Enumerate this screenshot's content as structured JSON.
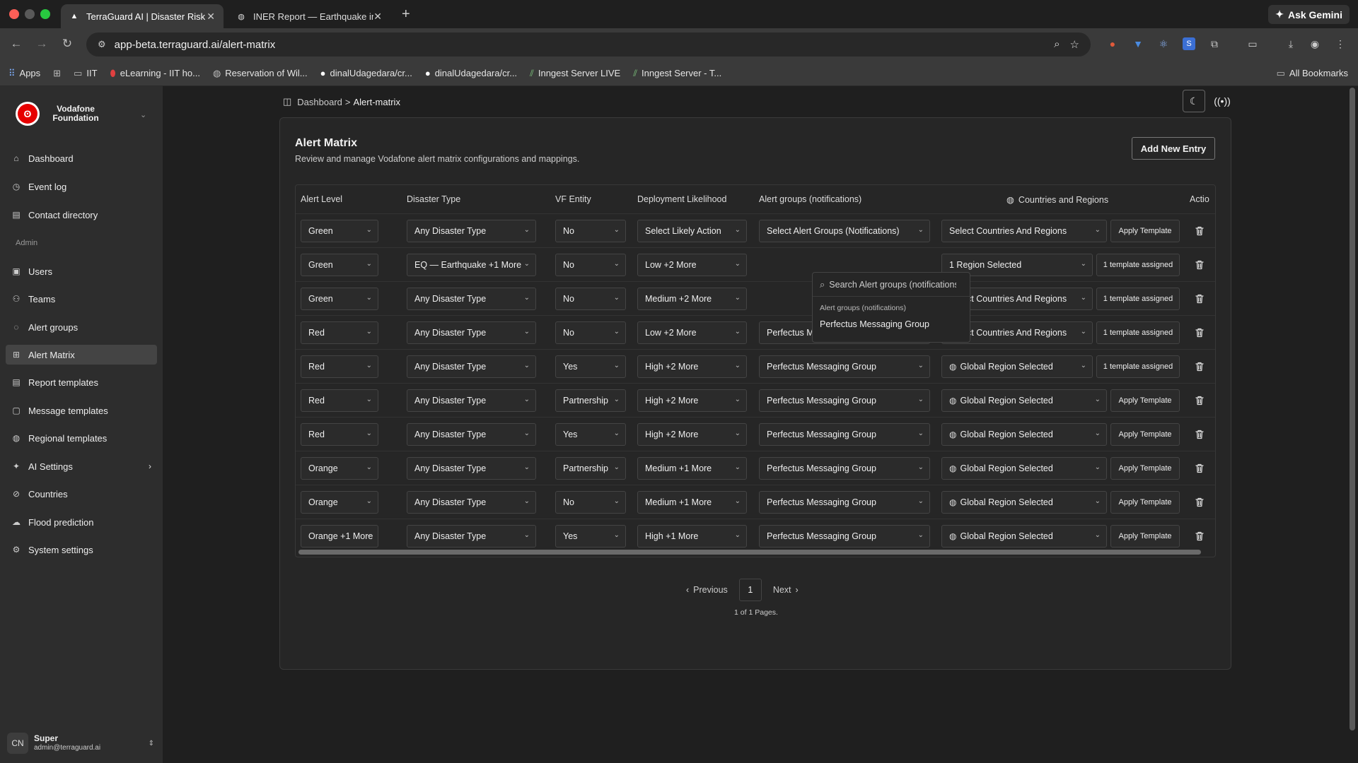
{
  "browser": {
    "tabs": [
      {
        "title": "TerraGuard AI | Disaster Risk",
        "active": true
      },
      {
        "title": "INER Report — Earthquake in",
        "active": false
      }
    ],
    "gemini_label": "Ask Gemini",
    "url": "app-beta.terraguard.ai/alert-matrix",
    "bookmarks": [
      "Apps",
      "",
      "IIT",
      "eLearning - IIT ho...",
      "Reservation of Wil...",
      "dinalUdagedara/cr...",
      "dinalUdagedara/cr...",
      "Inngest Server LIVE",
      "Inngest Server - T..."
    ],
    "all_bookmarks": "All Bookmarks"
  },
  "sidebar": {
    "org_name": "Vodafone Foundation",
    "items": [
      {
        "label": "Dashboard",
        "icon": "home-icon"
      },
      {
        "label": "Event log",
        "icon": "clock-icon"
      },
      {
        "label": "Contact directory",
        "icon": "book-icon"
      }
    ],
    "admin_label": "Admin",
    "admin_items": [
      {
        "label": "Users",
        "icon": "user-icon"
      },
      {
        "label": "Teams",
        "icon": "users-icon"
      },
      {
        "label": "Alert groups",
        "icon": "message-icon"
      },
      {
        "label": "Alert Matrix",
        "icon": "grid-icon",
        "active": true
      },
      {
        "label": "Report templates",
        "icon": "file-icon"
      },
      {
        "label": "Message templates",
        "icon": "message-square-icon"
      },
      {
        "label": "Regional templates",
        "icon": "globe-icon"
      },
      {
        "label": "AI Settings",
        "icon": "sparkles-icon"
      },
      {
        "label": "Countries",
        "icon": "globe-2-icon"
      },
      {
        "label": "Flood prediction",
        "icon": "cloud-icon"
      },
      {
        "label": "System settings",
        "icon": "gear-icon"
      }
    ],
    "user": {
      "initials": "CN",
      "name": "Super",
      "email": "admin@terraguard.ai"
    }
  },
  "breadcrumb": {
    "root": "Dashboard",
    "separator": ">",
    "current": "Alert-matrix"
  },
  "page": {
    "title": "Alert Matrix",
    "subtitle": "Review and manage Vodafone alert matrix configurations and mappings.",
    "add_button": "Add New Entry"
  },
  "table": {
    "headers": [
      "Alert Level",
      "Disaster Type",
      "VF Entity",
      "Deployment Likelihood",
      "Alert groups (notifications)",
      "Countries and Regions",
      "Actio"
    ],
    "rows": [
      {
        "level": "Green",
        "disaster": "Any Disaster Type",
        "entity": "No",
        "likelihood": "Select Likely Action",
        "groups": "Select Alert Groups (Notifications)",
        "regions": "Select Countries And Regions",
        "regions_globe": false,
        "action": "Apply Template"
      },
      {
        "level": "Green",
        "disaster": "EQ — Earthquake +1 More",
        "entity": "No",
        "likelihood": "Low +2 More",
        "groups": "",
        "regions": "1 Region Selected",
        "regions_globe": false,
        "action": "1 template assigned"
      },
      {
        "level": "Green",
        "disaster": "Any Disaster Type",
        "entity": "No",
        "likelihood": "Medium +2 More",
        "groups": "",
        "regions": "Select Countries And Regions",
        "regions_globe": false,
        "action": "1 template assigned"
      },
      {
        "level": "Red",
        "disaster": "Any Disaster Type",
        "entity": "No",
        "likelihood": "Low +2 More",
        "groups": "Perfectus Messaging Group",
        "regions": "Select Countries And Regions",
        "regions_globe": false,
        "action": "1 template assigned"
      },
      {
        "level": "Red",
        "disaster": "Any Disaster Type",
        "entity": "Yes",
        "likelihood": "High +2 More",
        "groups": "Perfectus Messaging Group",
        "regions": "Global Region Selected",
        "regions_globe": true,
        "action": "1 template assigned"
      },
      {
        "level": "Red",
        "disaster": "Any Disaster Type",
        "entity": "Partnership",
        "likelihood": "High +2 More",
        "groups": "Perfectus Messaging Group",
        "regions": "Global Region Selected",
        "regions_globe": true,
        "action": "Apply Template"
      },
      {
        "level": "Red",
        "disaster": "Any Disaster Type",
        "entity": "Yes",
        "likelihood": "High +2 More",
        "groups": "Perfectus Messaging Group",
        "regions": "Global Region Selected",
        "regions_globe": true,
        "action": "Apply Template"
      },
      {
        "level": "Orange",
        "disaster": "Any Disaster Type",
        "entity": "Partnership",
        "likelihood": "Medium +1 More",
        "groups": "Perfectus Messaging Group",
        "regions": "Global Region Selected",
        "regions_globe": true,
        "action": "Apply Template"
      },
      {
        "level": "Orange",
        "disaster": "Any Disaster Type",
        "entity": "No",
        "likelihood": "Medium +1 More",
        "groups": "Perfectus Messaging Group",
        "regions": "Global Region Selected",
        "regions_globe": true,
        "action": "Apply Template"
      },
      {
        "level": "Orange +1 More",
        "disaster": "Any Disaster Type",
        "entity": "Yes",
        "likelihood": "High +1 More",
        "groups": "Perfectus Messaging Group",
        "regions": "Global Region Selected",
        "regions_globe": true,
        "action": "Apply Template"
      }
    ]
  },
  "dropdown": {
    "search_placeholder": "Search Alert groups (notifications)",
    "group_label": "Alert groups (notifications)",
    "option": "Perfectus Messaging Group"
  },
  "pagination": {
    "previous": "Previous",
    "page": "1",
    "next": "Next",
    "info": "1 of 1 Pages."
  }
}
